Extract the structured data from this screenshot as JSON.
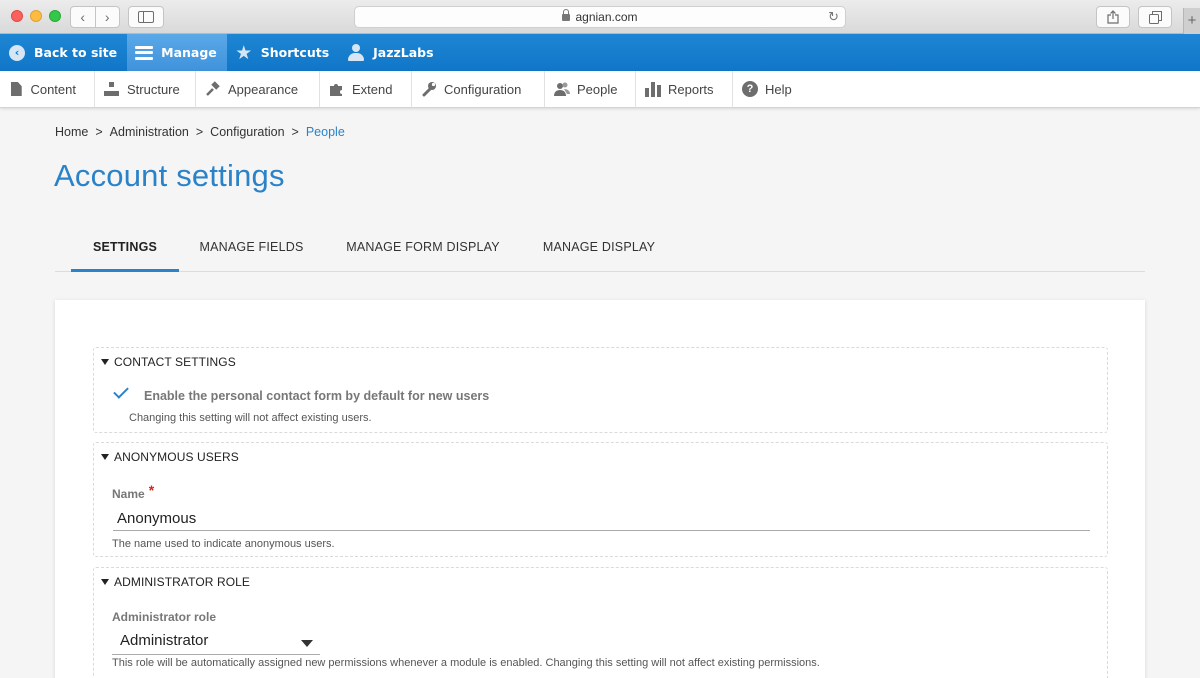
{
  "browser": {
    "url": "agnian.com",
    "nav_back": "‹",
    "nav_forward": "›",
    "reload": "↻",
    "plus": "+"
  },
  "toolbar": {
    "back_label": "Back to site",
    "manage_label": "Manage",
    "shortcuts_label": "Shortcuts",
    "user_label": "JazzLabs",
    "back_icon": "‹",
    "star_icon": "★"
  },
  "menu": {
    "items": [
      {
        "label": "Content",
        "icon": "document-icon"
      },
      {
        "label": "Structure",
        "icon": "sitemap-icon"
      },
      {
        "label": "Appearance",
        "icon": "paintbrush-icon"
      },
      {
        "label": "Extend",
        "icon": "puzzle-icon"
      },
      {
        "label": "Configuration",
        "icon": "wrench-icon"
      },
      {
        "label": "People",
        "icon": "people-icon"
      },
      {
        "label": "Reports",
        "icon": "bar-chart-icon"
      },
      {
        "label": "Help",
        "icon": "help-icon"
      }
    ],
    "glyphs": {
      "paint": "🔨",
      "puzzle": "✚",
      "wrench": "🔧",
      "people": "👥",
      "help": "?"
    }
  },
  "breadcrumb": {
    "items": [
      "Home",
      "Administration",
      "Configuration",
      "People"
    ],
    "separator": ">"
  },
  "page": {
    "title": "Account settings"
  },
  "tabs": [
    "SETTINGS",
    "MANAGE FIELDS",
    "MANAGE FORM DISPLAY",
    "MANAGE DISPLAY"
  ],
  "contact": {
    "legend": "CONTACT SETTINGS",
    "checkbox_label": "Enable the personal contact form by default for new users",
    "checked": true,
    "description": "Changing this setting will not affect existing users."
  },
  "anonymous": {
    "legend": "ANONYMOUS USERS",
    "field_label": "Name",
    "required_mark": "*",
    "value": "Anonymous",
    "description": "The name used to indicate anonymous users."
  },
  "admin_role": {
    "legend": "ADMINISTRATOR ROLE",
    "field_label": "Administrator role",
    "selected": "Administrator",
    "description": "This role will be automatically assigned new permissions whenever a module is enabled. Changing this setting will not affect existing permissions."
  },
  "colors": {
    "toolbar_blue": "#1176c8",
    "accent": "#2a83c9",
    "required": "#d0271d"
  }
}
